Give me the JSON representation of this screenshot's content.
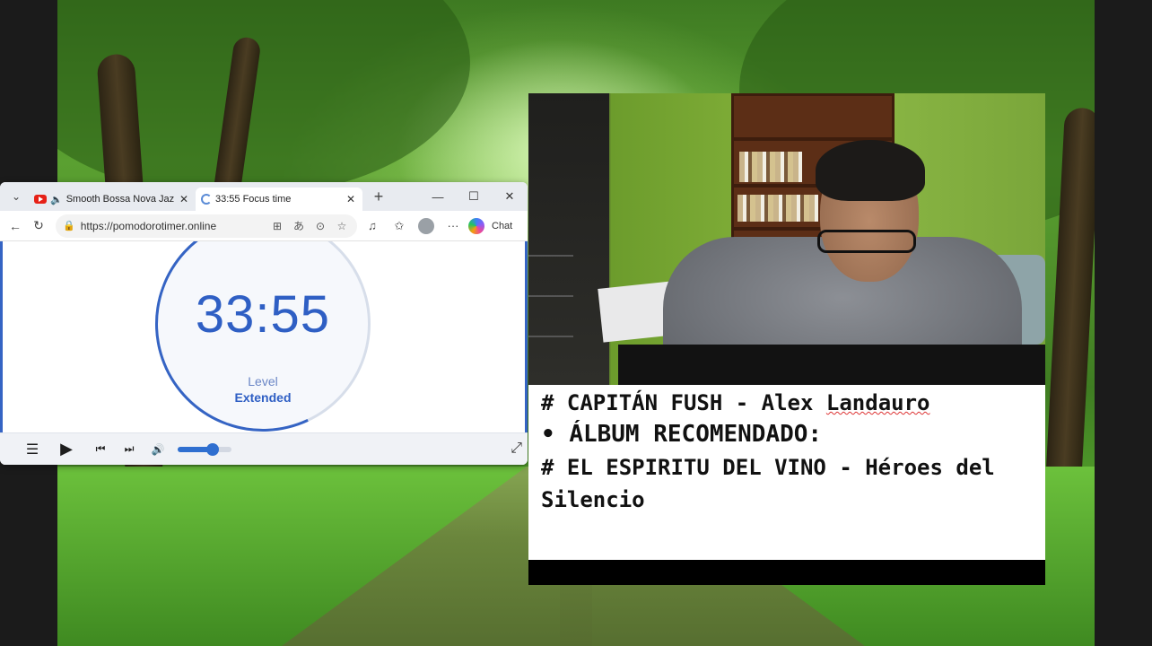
{
  "browser": {
    "tabs": [
      {
        "title": "Smooth Bossa Nova Jazz",
        "icon": "youtube-icon",
        "audio_icon": "speaker-icon",
        "active": false
      },
      {
        "title": "33:55 Focus time",
        "icon": "loading-spinner-icon",
        "active": true
      }
    ],
    "new_tab_glyph": "+",
    "window_controls": {
      "minimize": "—",
      "maximize": "☐",
      "close": "✕"
    },
    "nav": {
      "back": "←",
      "refresh": "↻"
    },
    "url": "https://pomodorotimer.online",
    "copilot_label": "Chat"
  },
  "timer": {
    "time": "33:55",
    "level_label": "Level",
    "mode": "Extended",
    "accent_color": "#2f5fc4"
  },
  "player": {
    "menu": "☰",
    "play": "▶",
    "prev": "⏮",
    "next": "⏭",
    "volume_icon": "🔊",
    "volume_level": 0.65,
    "fullscreen": "⤢"
  },
  "captions": {
    "line1_prefix": "# CAPITÁN FUSH - Alex ",
    "line1_name": "Landauro",
    "line2": "ÁLBUM RECOMENDADO:",
    "line2_bullet": "•",
    "line3": "# EL ESPIRITU DEL VINO - Héroes del Silencio"
  }
}
